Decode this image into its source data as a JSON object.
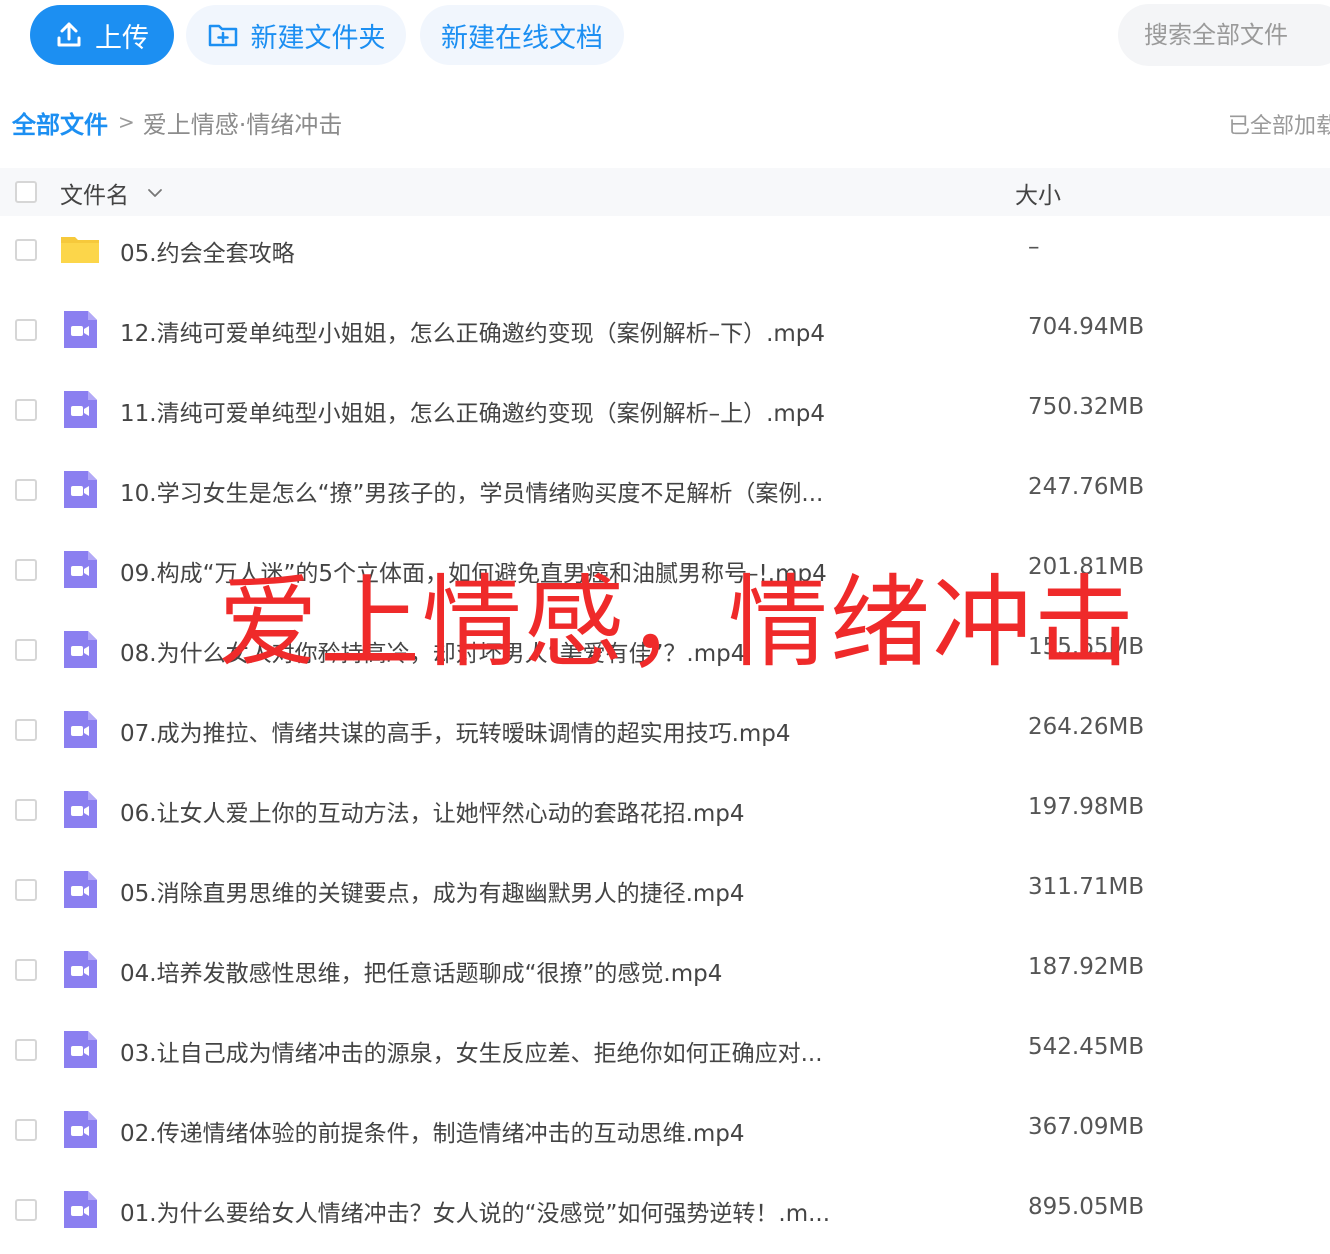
{
  "toolbar": {
    "upload_label": "上传",
    "new_folder_label": "新建文件夹",
    "new_online_doc_label": "新建在线文档",
    "search_placeholder": "搜索全部文件",
    "accent_color": "#1c8ff2"
  },
  "breadcrumb": {
    "root": "全部文件",
    "separator": ">",
    "current": "爱上情感·情绪冲击"
  },
  "status": {
    "loaded_text": "已全部加载"
  },
  "table": {
    "header_name": "文件名",
    "header_size": "大小",
    "rows": [
      {
        "type": "folder",
        "name": "05.约会全套攻略",
        "size": "–",
        "icon": "folder-icon"
      },
      {
        "type": "video",
        "name": "12.清纯可爱单纯型小姐姐，怎么正确邀约变现（案例解析–下）.mp4",
        "size": "704.94MB",
        "icon": "video-file-icon"
      },
      {
        "type": "video",
        "name": "11.清纯可爱单纯型小姐姐，怎么正确邀约变现（案例解析–上）.mp4",
        "size": "750.32MB",
        "icon": "video-file-icon"
      },
      {
        "type": "video",
        "name": "10.学习女生是怎么“撩”男孩子的，学员情绪购买度不足解析（案例...",
        "size": "247.76MB",
        "icon": "video-file-icon"
      },
      {
        "type": "video",
        "name": "09.构成“万人迷”的5个立体面，如何避免直男癌和油腻男称号–!.mp4",
        "size": "201.81MB",
        "icon": "video-file-icon"
      },
      {
        "type": "video",
        "name": "08.为什么女人对你矜持高冷，却对坏男人“美爱有佳”？.mp4",
        "size": "155.65MB",
        "icon": "video-file-icon"
      },
      {
        "type": "video",
        "name": "07.成为推拉、情绪共谋的高手，玩转暧昧调情的超实用技巧.mp4",
        "size": "264.26MB",
        "icon": "video-file-icon"
      },
      {
        "type": "video",
        "name": "06.让女人爱上你的互动方法，让她怦然心动的套路花招.mp4",
        "size": "197.98MB",
        "icon": "video-file-icon"
      },
      {
        "type": "video",
        "name": "05.消除直男思维的关键要点，成为有趣幽默男人的捷径.mp4",
        "size": "311.71MB",
        "icon": "video-file-icon"
      },
      {
        "type": "video",
        "name": "04.培养发散感性思维，把任意话题聊成“很撩”的感觉.mp4",
        "size": "187.92MB",
        "icon": "video-file-icon"
      },
      {
        "type": "video",
        "name": "03.让自己成为情绪冲击的源泉，女生反应差、拒绝你如何正确应对...",
        "size": "542.45MB",
        "icon": "video-file-icon"
      },
      {
        "type": "video",
        "name": "02.传递情绪体验的前提条件，制造情绪冲击的互动思维.mp4",
        "size": "367.09MB",
        "icon": "video-file-icon"
      },
      {
        "type": "video",
        "name": "01.为什么要给女人情绪冲击？女人说的“没感觉”如何强势逆转！.m...",
        "size": "895.05MB",
        "icon": "video-file-icon"
      }
    ]
  },
  "watermark": {
    "text": "爱上情感，情绪冲击",
    "color": "#ef2a2a"
  }
}
